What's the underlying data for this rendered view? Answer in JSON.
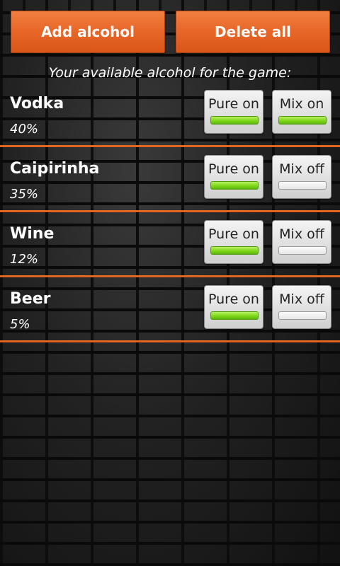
{
  "toolbar": {
    "add_label": "Add alcohol",
    "delete_label": "Delete all"
  },
  "subtitle": "Your available alcohol for the game:",
  "items": [
    {
      "name": "Vodka",
      "percent": "40%",
      "pure_label": "Pure on",
      "pure_on": true,
      "mix_label": "Mix on",
      "mix_on": true
    },
    {
      "name": "Caipirinha",
      "percent": "35%",
      "pure_label": "Pure on",
      "pure_on": true,
      "mix_label": "Mix off",
      "mix_on": false
    },
    {
      "name": "Wine",
      "percent": "12%",
      "pure_label": "Pure on",
      "pure_on": true,
      "mix_label": "Mix off",
      "mix_on": false
    },
    {
      "name": "Beer",
      "percent": "5%",
      "pure_label": "Pure on",
      "pure_on": true,
      "mix_label": "Mix off",
      "mix_on": false
    }
  ],
  "colors": {
    "accent": "#e8682a",
    "divider": "#e6651e",
    "indicator_on": "#7fd81a"
  }
}
